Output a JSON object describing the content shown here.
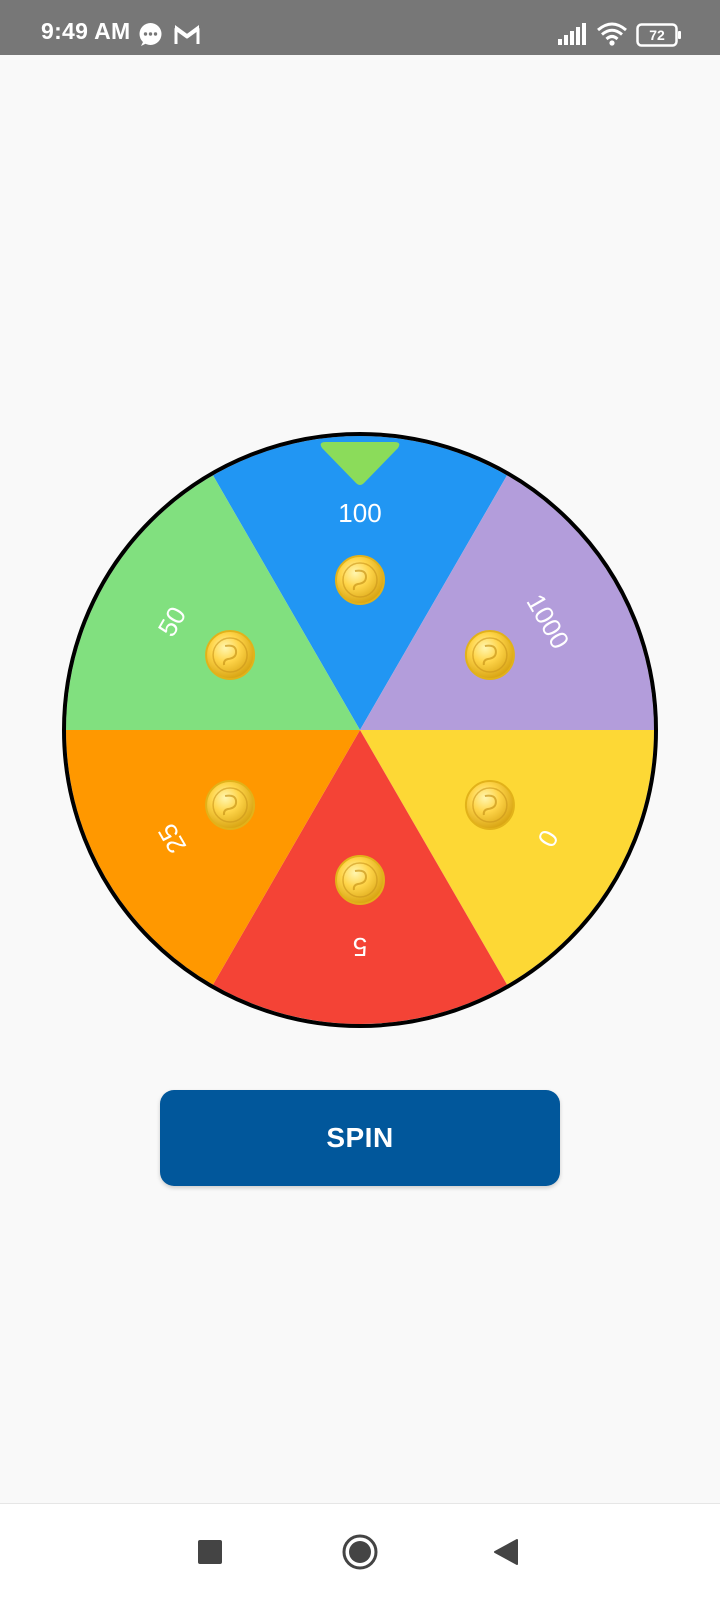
{
  "status_bar": {
    "time": "9:49 AM",
    "battery": "72",
    "icons": [
      "chat-bubble-icon",
      "gmail-icon",
      "signal-icon",
      "wifi-icon",
      "battery-icon"
    ]
  },
  "wheel": {
    "pointer_color": "#8bdc5a",
    "rim_color": "#000000",
    "segments": [
      {
        "label": "100",
        "color": "#2196f3"
      },
      {
        "label": "1000",
        "color": "#b39ddb"
      },
      {
        "label": "0",
        "color": "#fdd835"
      },
      {
        "label": "5",
        "color": "#f44336"
      },
      {
        "label": "25",
        "color": "#ff9800"
      },
      {
        "label": "50",
        "color": "#81e07f"
      }
    ],
    "segment_icon": "gold-coin-icon"
  },
  "spin_button": {
    "label": "SPIN",
    "color": "#01579b"
  },
  "nav_bar": {
    "buttons": [
      "recents-button",
      "home-button",
      "back-button"
    ]
  }
}
